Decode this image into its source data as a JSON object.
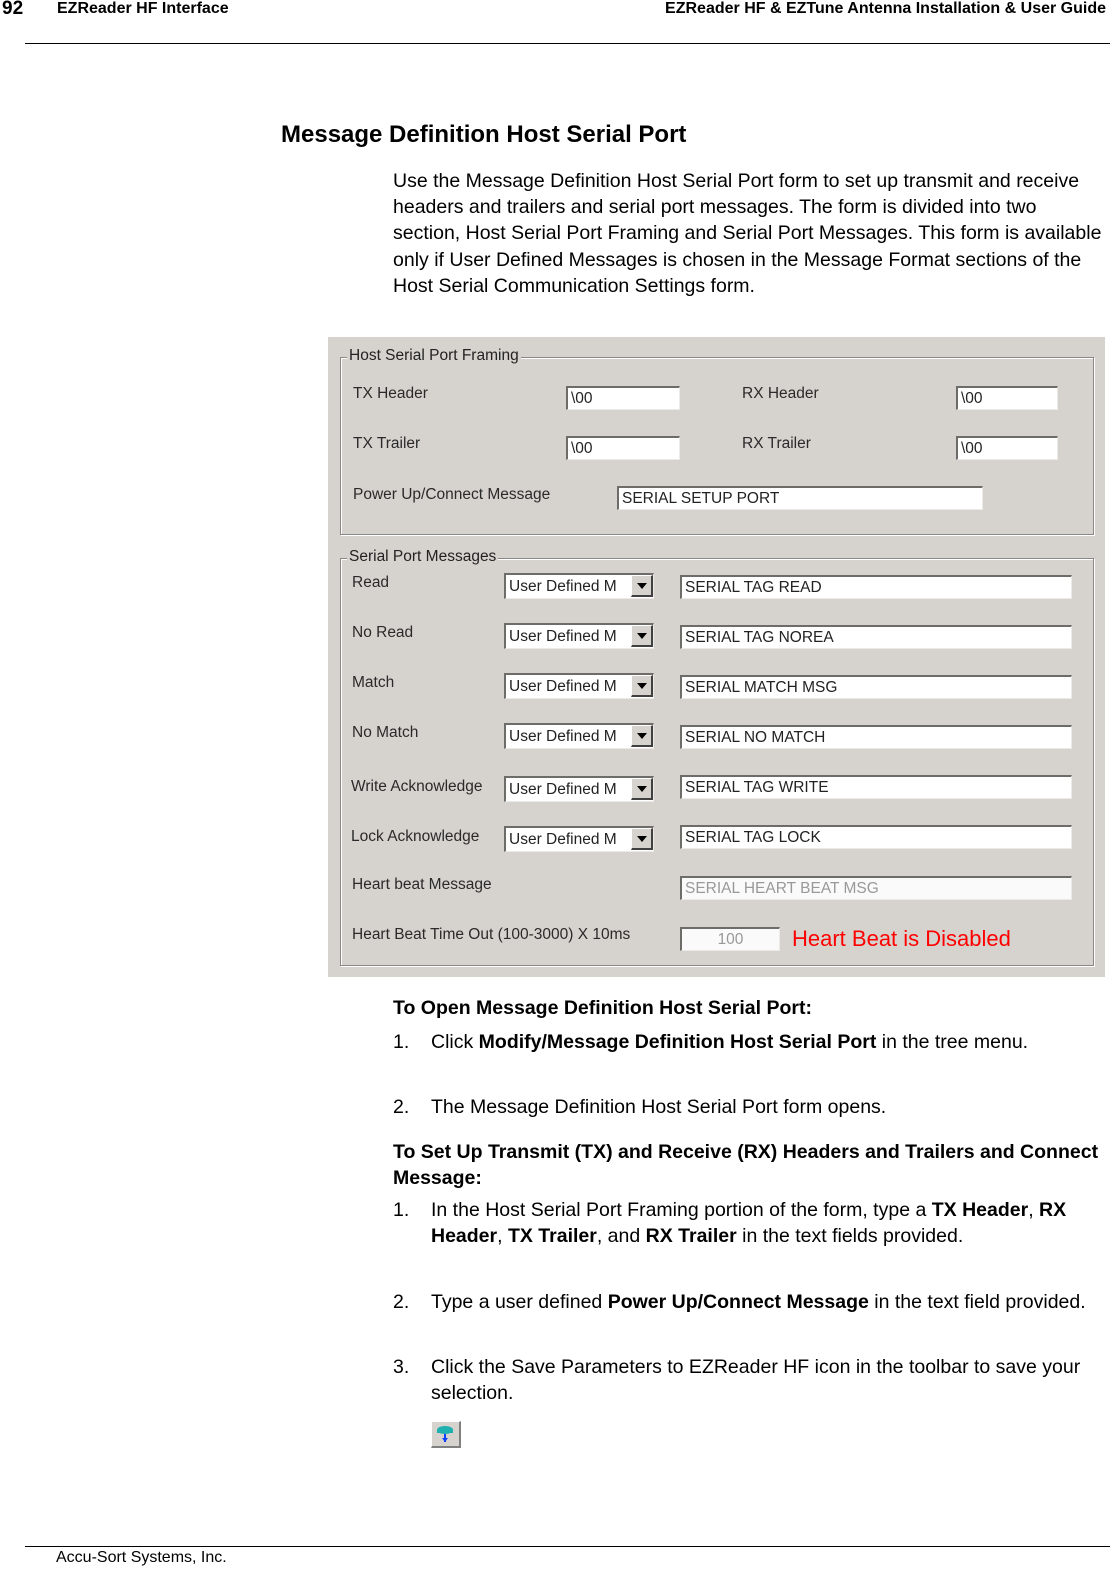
{
  "header": {
    "page_number": "92",
    "section": "EZReader HF Interface",
    "guide_title": "EZReader HF & EZTune Antenna Installation & User Guide"
  },
  "title": "Message Definition Host Serial Port",
  "intro": "Use the Message Definition Host Serial Port form to set up transmit and receive headers and trailers and serial port messages. The form is divided into two section, Host Serial Port Framing and Serial Port Messages. This form is available only if User Defined Messages is chosen in the Message Format sections of the Host Serial Communication Settings form.",
  "form": {
    "framing": {
      "legend": "Host Serial Port Framing",
      "tx_header_label": "TX Header",
      "tx_header_value": "\\00",
      "rx_header_label": "RX Header",
      "rx_header_value": "\\00",
      "tx_trailer_label": "TX Trailer",
      "tx_trailer_value": "\\00",
      "rx_trailer_label": "RX Trailer",
      "rx_trailer_value": "\\00",
      "power_up_label": "Power Up/Connect Message",
      "power_up_value": "SERIAL SETUP PORT"
    },
    "messages": {
      "legend": "Serial Port Messages",
      "rows": [
        {
          "label": "Read",
          "format": "User Defined M",
          "value": "SERIAL TAG READ"
        },
        {
          "label": "No Read",
          "format": "User Defined M",
          "value": "SERIAL TAG NOREA"
        },
        {
          "label": "Match",
          "format": "User Defined M",
          "value": "SERIAL MATCH MSG"
        },
        {
          "label": "No Match",
          "format": "User Defined M",
          "value": "SERIAL NO MATCH"
        },
        {
          "label": "Write Acknowledge",
          "format": "User Defined M",
          "value": "SERIAL TAG WRITE"
        },
        {
          "label": "Lock Acknowledge",
          "format": "User Defined M",
          "value": "SERIAL TAG LOCK"
        }
      ],
      "heartbeat_label": "Heart beat Message",
      "heartbeat_value": "SERIAL HEART BEAT MSG",
      "timeout_label": "Heart Beat Time Out (100-3000) X 10ms",
      "timeout_value": "100",
      "heartbeat_status": "Heart Beat is Disabled",
      "status_color": "#ff0000"
    }
  },
  "open_section": {
    "heading": "To Open Message Definition Host Serial Port:",
    "steps": [
      {
        "num": "1.",
        "pre": "Click ",
        "bold": "Modify/Message Definition Host Serial Port",
        "post": " in the tree menu."
      },
      {
        "num": "2.",
        "text": "The Message Definition Host Serial Port form opens."
      }
    ]
  },
  "setup_section": {
    "heading": "To Set Up Transmit (TX) and Receive (RX) Headers and Trailers and Connect Message:",
    "step1": {
      "num": "1.",
      "t1": "In the Host Serial Port Framing portion of the form, type a ",
      "b1": "TX Header",
      "t2": ", ",
      "b2": "RX Header",
      "t3": ", ",
      "b3": "TX Trailer",
      "t4": ", and ",
      "b4": "RX Trailer",
      "t5": " in the text fields provided."
    },
    "step2": {
      "num": "2.",
      "t1": "Type a user defined ",
      "b1": "Power Up/Connect Message",
      "t2": " in the text field provided."
    },
    "step3": {
      "num": "3.",
      "text": "Click the Save Parameters to EZReader HF icon in the toolbar to save your selection."
    },
    "icon": "save-parameters-icon"
  },
  "footer": "Accu-Sort Systems, Inc."
}
